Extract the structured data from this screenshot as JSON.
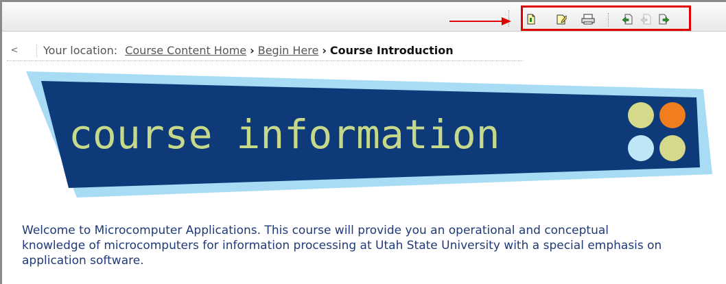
{
  "toolbar": {
    "icons": [
      "page-icon",
      "edit-page-icon",
      "print-icon",
      "previous-page-icon",
      "up-page-icon",
      "next-page-icon"
    ]
  },
  "breadcrumb": {
    "back_glyph": "<",
    "prefix": "Your location:",
    "links": [
      "Course Content Home",
      "Begin Here"
    ],
    "separator": "›",
    "current": "Course Introduction"
  },
  "banner": {
    "title": "course information",
    "colors": {
      "outer": "#a8dcf4",
      "inner": "#0f3a7a",
      "text": "#c6d98a",
      "dot_yellow": "#d5d98a",
      "dot_orange": "#f07d1e",
      "dot_blue": "#bfe6f7"
    }
  },
  "main": {
    "welcome_text": "Welcome to Microcomputer Applications. This course will provide you an operational and conceptual knowledge of microcomputers for information processing at Utah State University with a special emphasis on application software."
  },
  "colors": {
    "highlight": "#e00000",
    "body_text": "#1f3a78"
  }
}
